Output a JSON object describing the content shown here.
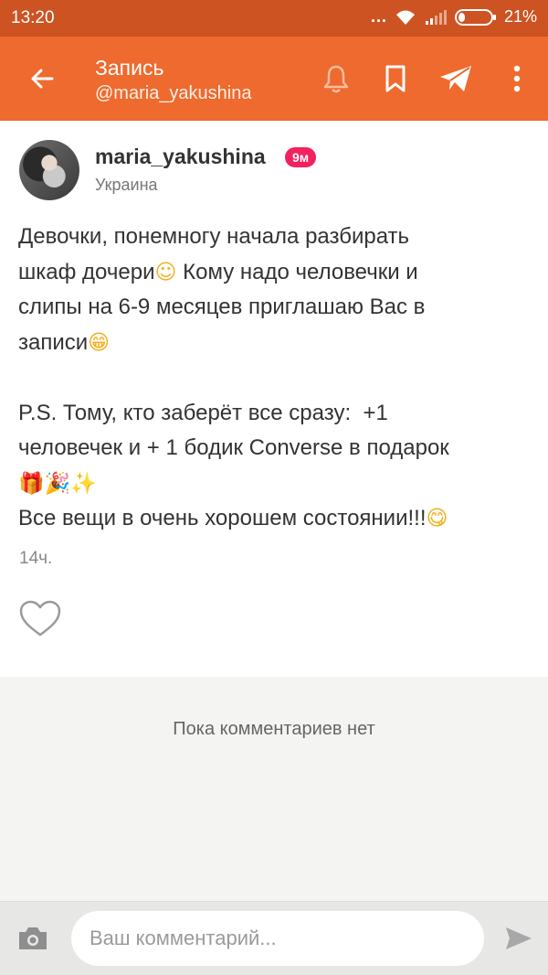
{
  "status_bar": {
    "time": "13:20",
    "dots": "...",
    "battery_percent": "21%",
    "battery_level": 0.21
  },
  "app_bar": {
    "title": "Запись",
    "subtitle": "@maria_yakushina"
  },
  "post": {
    "author": "maria_yakushina",
    "age_badge": "9м",
    "location": "Украина",
    "text_lines": [
      "Девочки, понемногу начала разбирать",
      "шкаф дочери",
      " Кому надо человечки и",
      "слипы на 6-9 месяцев приглашаю Вас в",
      "записи",
      "P.S. Тому, кто заберёт все сразу:  +1",
      "человечек и + 1 бодик Converse в подарок",
      "Все вещи в очень хорошем состоянии!!!"
    ],
    "emojis": {
      "smile": "☺",
      "grin": "😁",
      "gift": "🎁",
      "party": "🎉",
      "sparkles": "✨",
      "yum": "😋"
    },
    "time": "14ч."
  },
  "comments": {
    "empty_text": "Пока комментариев нет"
  },
  "comment_input": {
    "placeholder": "Ваш комментарий..."
  },
  "colors": {
    "status_bar": "#cd5322",
    "app_bar": "#ee6a2e",
    "badge": "#f4215f",
    "comments_bg": "#f4f4f2"
  },
  "icons": [
    "back-arrow-icon",
    "bell-icon",
    "bookmark-icon",
    "send-icon",
    "more-vert-icon",
    "heart-icon",
    "camera-icon",
    "send-comment-icon",
    "wifi-icon",
    "signal-icon",
    "battery-icon"
  ]
}
